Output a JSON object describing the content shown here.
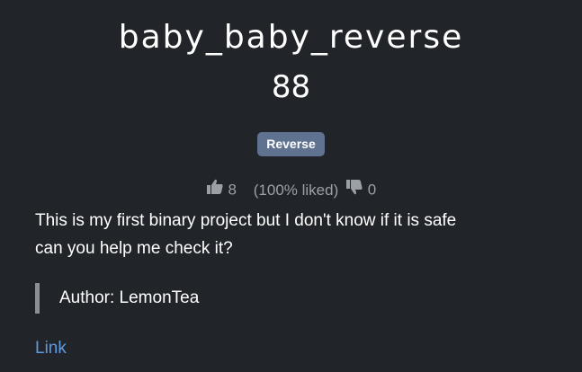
{
  "challenge": {
    "name": "baby_baby_reverse",
    "value": "88",
    "tag": "Reverse"
  },
  "rating": {
    "likes": "8",
    "liked_text": "(100% liked)",
    "dislikes": "0"
  },
  "description": {
    "line1": "This is my first binary project but I don't know if it is safe",
    "line2": "can you help me check it?"
  },
  "author": {
    "text": "Author: LemonTea"
  },
  "link": {
    "label": "Link"
  },
  "colors": {
    "background": "#212529",
    "tag_background": "#5f7290",
    "muted_text": "#9aa0a6",
    "link": "#5e9be0",
    "blockquote_border": "#8a8f96"
  },
  "icons": {
    "like": "thumbs-up-icon",
    "dislike": "thumbs-down-icon"
  }
}
